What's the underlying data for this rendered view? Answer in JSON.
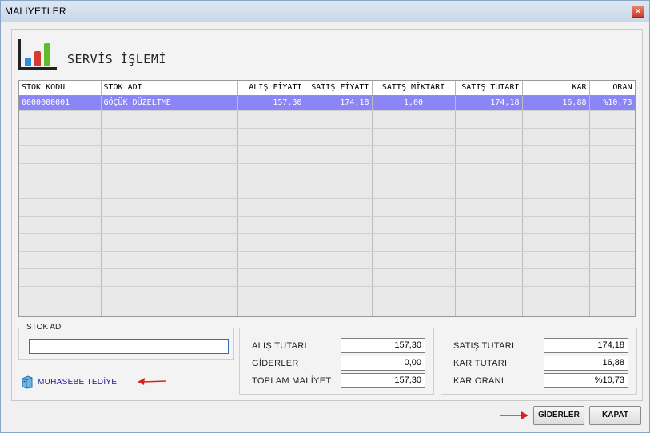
{
  "window": {
    "title": "MALİYETLER",
    "close_label": "×"
  },
  "header": {
    "title": "SERVİS İŞLEMİ",
    "icon": "bar-chart-icon"
  },
  "grid": {
    "columns": [
      "STOK KODU",
      "STOK ADI",
      "ALIŞ FİYATI",
      "SATIŞ FİYATI",
      "SATIŞ MİKTARI",
      "SATIŞ TUTARI",
      "KAR",
      "ORAN"
    ],
    "rows": [
      [
        "0000000001",
        "GÖÇÜK DÜZELTME",
        "157,30",
        "174,18",
        "1,00",
        "174,18",
        "16,88",
        "%10,73"
      ]
    ],
    "selected_row_color": "#8b86f5"
  },
  "stok": {
    "legend": "STOK ADI",
    "value": ""
  },
  "muhasebe": {
    "label": "MUHASEBE TEDİYE",
    "icon": "cabinet-icon"
  },
  "costs": {
    "alis_label": "ALIŞ TUTARI",
    "alis_value": "157,30",
    "gider_label": "GİDERLER",
    "gider_value": "0,00",
    "toplam_label": "TOPLAM MALİYET",
    "toplam_value": "157,30"
  },
  "sales": {
    "satis_label": "SATIŞ TUTARI",
    "satis_value": "174,18",
    "kar_label": "KAR TUTARI",
    "kar_value": "16,88",
    "oran_label": "KAR ORANI",
    "oran_value": "%10,73"
  },
  "buttons": {
    "giderler": "GİDERLER",
    "kapat": "KAPAT"
  },
  "colors": {
    "accent": "#1b1b9e",
    "arrow": "#e0201f"
  }
}
